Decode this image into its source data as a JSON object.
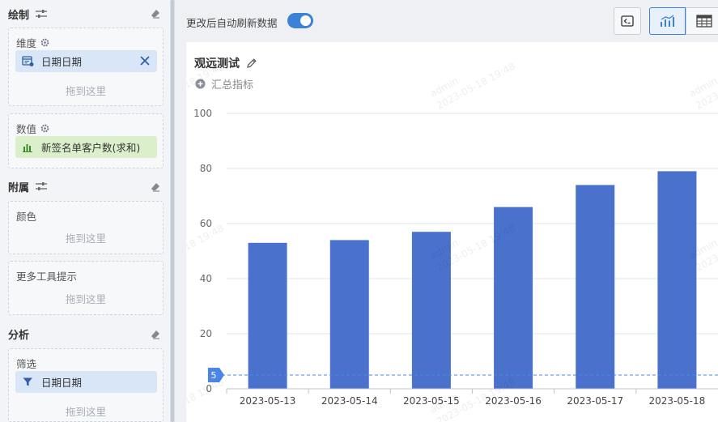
{
  "left_panel": {
    "draw": {
      "title": "绘制",
      "dimension": {
        "title": "维度",
        "field": "日期日期",
        "drop_hint": "拖到这里"
      },
      "measure": {
        "title": "数值",
        "field": "新签名单客户数(求和)"
      }
    },
    "attach": {
      "title": "附属",
      "color": {
        "title": "颜色",
        "drop_hint": "拖到这里"
      },
      "tooltip": {
        "title": "更多工具提示",
        "drop_hint": "拖到这里"
      }
    },
    "analysis": {
      "title": "分析",
      "filter": {
        "title": "筛选",
        "field": "日期日期",
        "drop_hint": "拖到这里"
      }
    }
  },
  "toolbar": {
    "auto_refresh_label": "更改后自动刷新数据",
    "auto_refresh_on": true,
    "active_view": "chart"
  },
  "chart": {
    "title": "观远测试",
    "summary_label": "汇总指标",
    "watermark_user": "admin",
    "watermark_time": "2023-05-18 19:48"
  },
  "chart_data": {
    "type": "bar",
    "categories": [
      "2023-05-13",
      "2023-05-14",
      "2023-05-15",
      "2023-05-16",
      "2023-05-17",
      "2023-05-18"
    ],
    "values": [
      53,
      54,
      57,
      66,
      74,
      79
    ],
    "ylim": [
      0,
      100
    ],
    "yticks": [
      0,
      20,
      40,
      60,
      80,
      100
    ],
    "reference_line": {
      "value": 5,
      "label": "5"
    },
    "bar_color": "#4a72cc",
    "grid": true,
    "legend": "none",
    "title": "",
    "xlabel": "",
    "ylabel": ""
  },
  "colors": {
    "accent": "#3b82d6",
    "dimension_pill": "#d9e6f8",
    "measure_pill": "#dcefcb"
  }
}
